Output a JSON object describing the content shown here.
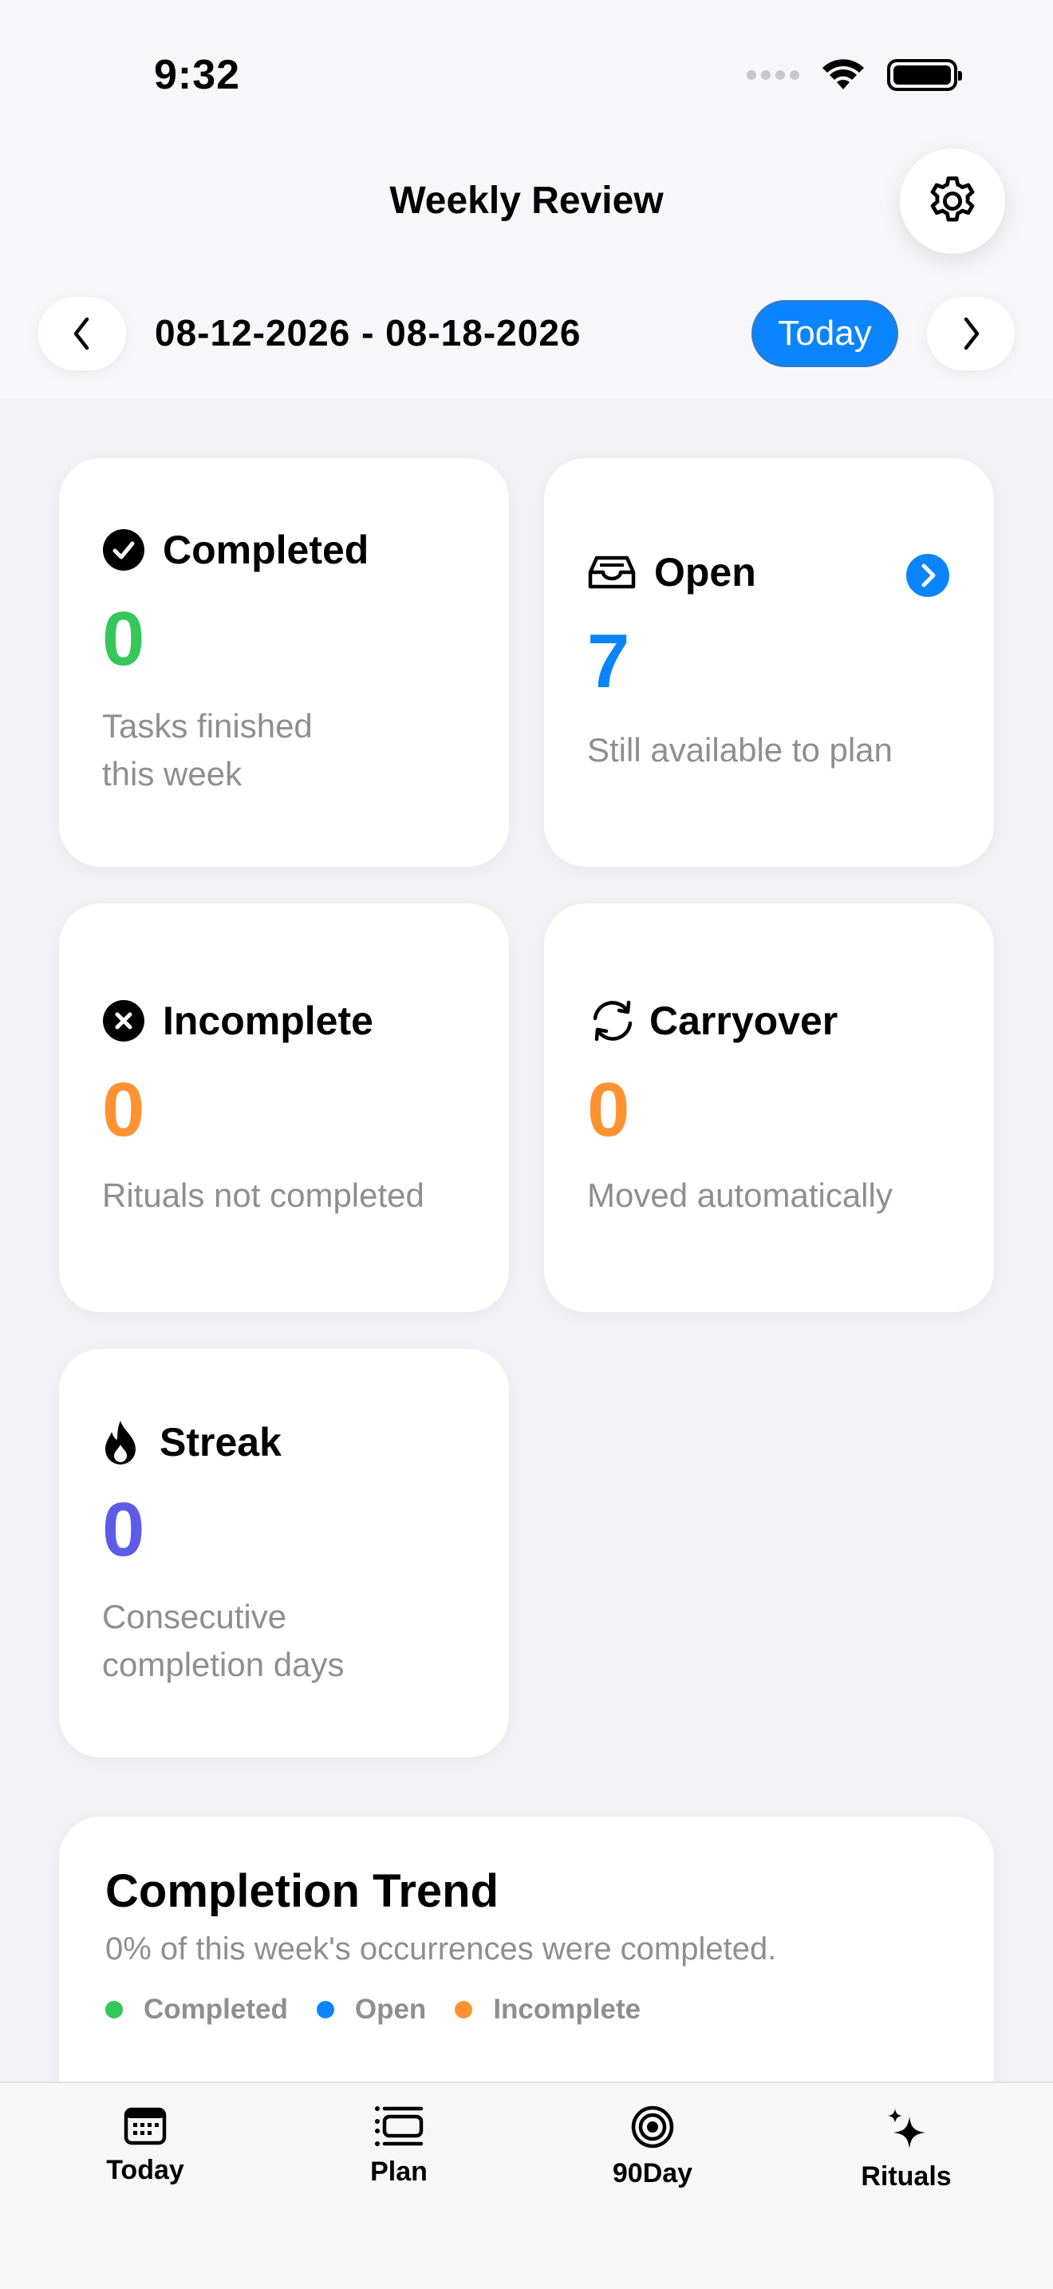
{
  "status": {
    "time": "9:32"
  },
  "header": {
    "title": "Weekly Review",
    "date_range": "08-12-2026 - 08-18-2026",
    "today_label": "Today"
  },
  "cards": {
    "completed": {
      "title": "Completed",
      "value": "0",
      "desc": "Tasks finished this week",
      "color": "#34c759"
    },
    "open": {
      "title": "Open",
      "value": "7",
      "desc": "Still available to plan",
      "color": "#0a84ff"
    },
    "incomplete": {
      "title": "Incomplete",
      "value": "0",
      "desc": "Rituals not completed",
      "color": "#ff9230"
    },
    "carryover": {
      "title": "Carryover",
      "value": "0",
      "desc": "Moved automatically",
      "color": "#ff9230"
    },
    "streak": {
      "title": "Streak",
      "value": "0",
      "desc": "Consecutive completion days",
      "color": "#5e5ce6"
    }
  },
  "trend": {
    "title": "Completion Trend",
    "subtitle": "0% of this week's occurrences were completed.",
    "legend": [
      {
        "label": "Completed",
        "color": "#34c759"
      },
      {
        "label": "Open",
        "color": "#0a84ff"
      },
      {
        "label": "Incomplete",
        "color": "#ff9230"
      }
    ]
  },
  "tabs": [
    {
      "label": "Today",
      "icon": "calendar-icon"
    },
    {
      "label": "Plan",
      "icon": "list-icon"
    },
    {
      "label": "90Day",
      "icon": "target-icon"
    },
    {
      "label": "Rituals",
      "icon": "sparkles-icon"
    }
  ]
}
